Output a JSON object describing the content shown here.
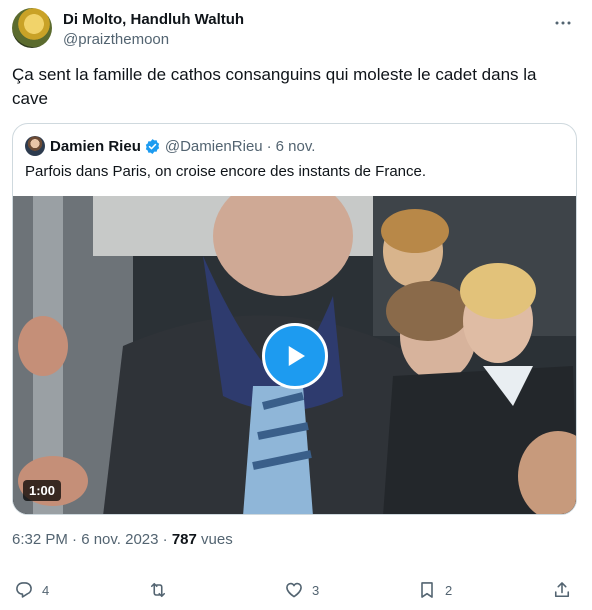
{
  "tweet": {
    "author_name": "Di Molto, Handluh Waltuh",
    "author_handle": "@praizthemoon",
    "text": "Ça sent la famille de cathos consanguins qui moleste le cadet dans la cave",
    "timestamp": "6:32 PM · 6 nov. 2023",
    "views_count": "787",
    "views_label": "vues"
  },
  "quote": {
    "author_name": "Damien Rieu",
    "author_handle": "@DamienRieu",
    "separator": "·",
    "date": "6 nov.",
    "text": "Parfois dans Paris, on croise encore des instants de France.",
    "video_duration": "1:00"
  },
  "actions": {
    "replies": "4",
    "retweets": "",
    "likes": "3",
    "bookmarks": "2"
  },
  "colors": {
    "accent": "#1d9bf0",
    "text": "#0f1419",
    "muted": "#536471",
    "border": "#cfd9de"
  },
  "icons": [
    "more-icon",
    "verified-icon",
    "play-icon",
    "reply-icon",
    "retweet-icon",
    "like-icon",
    "bookmark-icon",
    "share-icon"
  ]
}
